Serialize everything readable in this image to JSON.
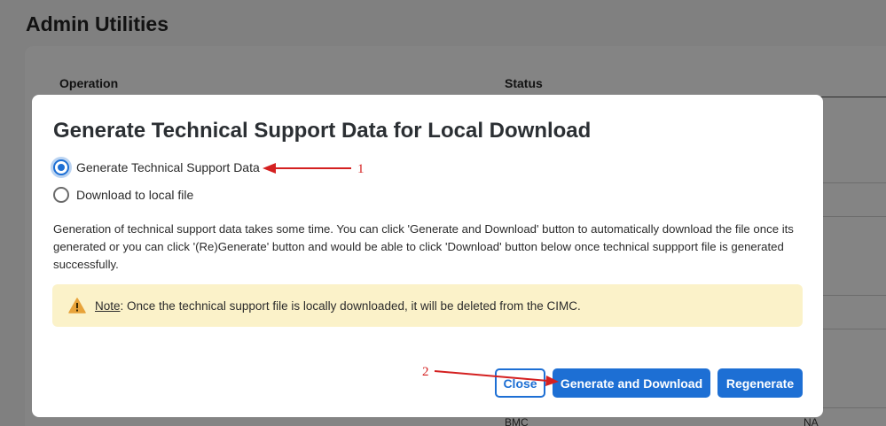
{
  "page": {
    "title": "Admin Utilities",
    "table_headers": {
      "operation": "Operation",
      "status": "Status"
    },
    "partial_row": {
      "name": "BMC",
      "status": "NA"
    }
  },
  "dialog": {
    "title": "Generate Technical Support Data for Local Download",
    "options": [
      {
        "label": "Generate Technical Support Data",
        "selected": true
      },
      {
        "label": "Download to local file",
        "selected": false
      }
    ],
    "description": "Generation of technical support data takes some time. You can click 'Generate and Download' button to automatically download the file once its generated or you can click '(Re)Generate' button and would be able to click 'Download' button below once technical suppport file is generated successfully.",
    "note": {
      "label": "Note",
      "text": ": Once the technical support file is locally downloaded, it will be deleted from the CIMC.",
      "icon": "warning-icon"
    },
    "buttons": {
      "close": "Close",
      "generate_download": "Generate and Download",
      "regenerate": "Regenerate"
    }
  },
  "annotations": {
    "marker1": "1",
    "marker2": "2"
  },
  "colors": {
    "accent": "#1d6fd4",
    "note_bg": "#fbf2c9",
    "warning": "#e8a33a",
    "annotation": "#d42020"
  }
}
